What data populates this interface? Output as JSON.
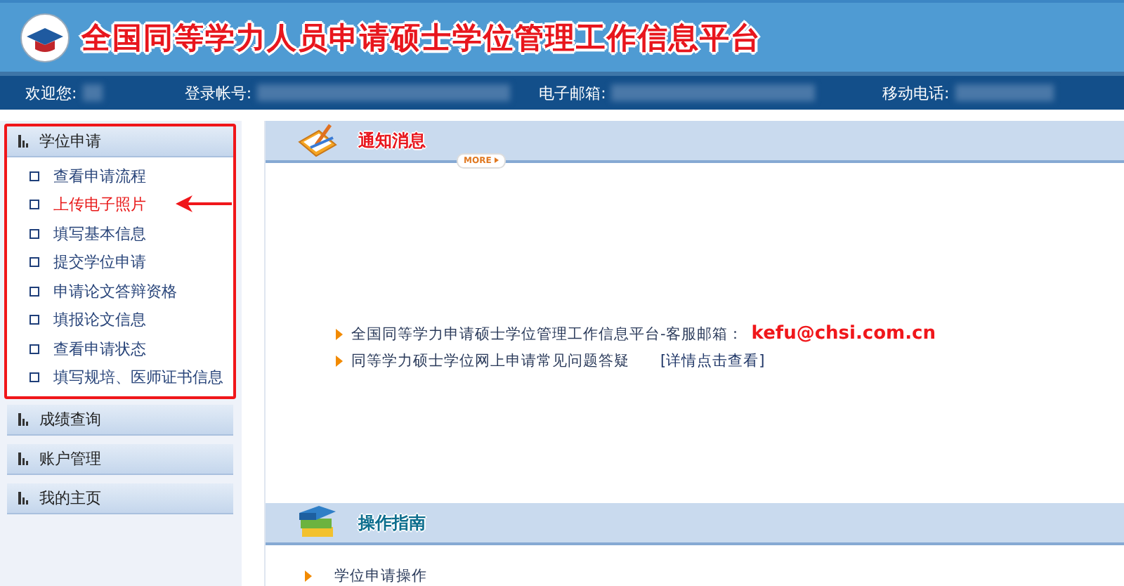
{
  "header": {
    "title": "全国同等学力人员申请硕士学位管理工作信息平台"
  },
  "info_bar": [
    {
      "label": "欢迎您:"
    },
    {
      "label": "登录帐号:"
    },
    {
      "label": "电子邮箱:"
    },
    {
      "label": "移动电话:"
    }
  ],
  "sidebar": [
    {
      "title": "学位申请",
      "highlighted": true,
      "items": [
        {
          "label": "查看申请流程",
          "selected": false
        },
        {
          "label": "上传电子照片",
          "selected": true
        },
        {
          "label": "填写基本信息",
          "selected": false
        },
        {
          "label": "提交学位申请",
          "selected": false
        },
        {
          "label": "申请论文答辩资格",
          "selected": false
        },
        {
          "label": "填报论文信息",
          "selected": false
        },
        {
          "label": "查看申请状态",
          "selected": false
        },
        {
          "label": "填写规培、医师证书信息",
          "selected": false
        }
      ]
    },
    {
      "title": "成绩查询",
      "highlighted": false
    },
    {
      "title": "账户管理",
      "highlighted": false
    },
    {
      "title": "我的主页",
      "highlighted": false
    }
  ],
  "notice": {
    "title": "通知消息",
    "more": "MORE",
    "lines": [
      {
        "text": "全国同等学力申请硕士学位管理工作信息平台-客服邮箱：",
        "email": "kefu@chsi.com.cn"
      },
      {
        "text": "同等学力硕士学位网上申请常见问题答疑",
        "link": "[详情点击查看]"
      }
    ]
  },
  "guide": {
    "title": "操作指南",
    "items": [
      "学位申请操作"
    ]
  }
}
